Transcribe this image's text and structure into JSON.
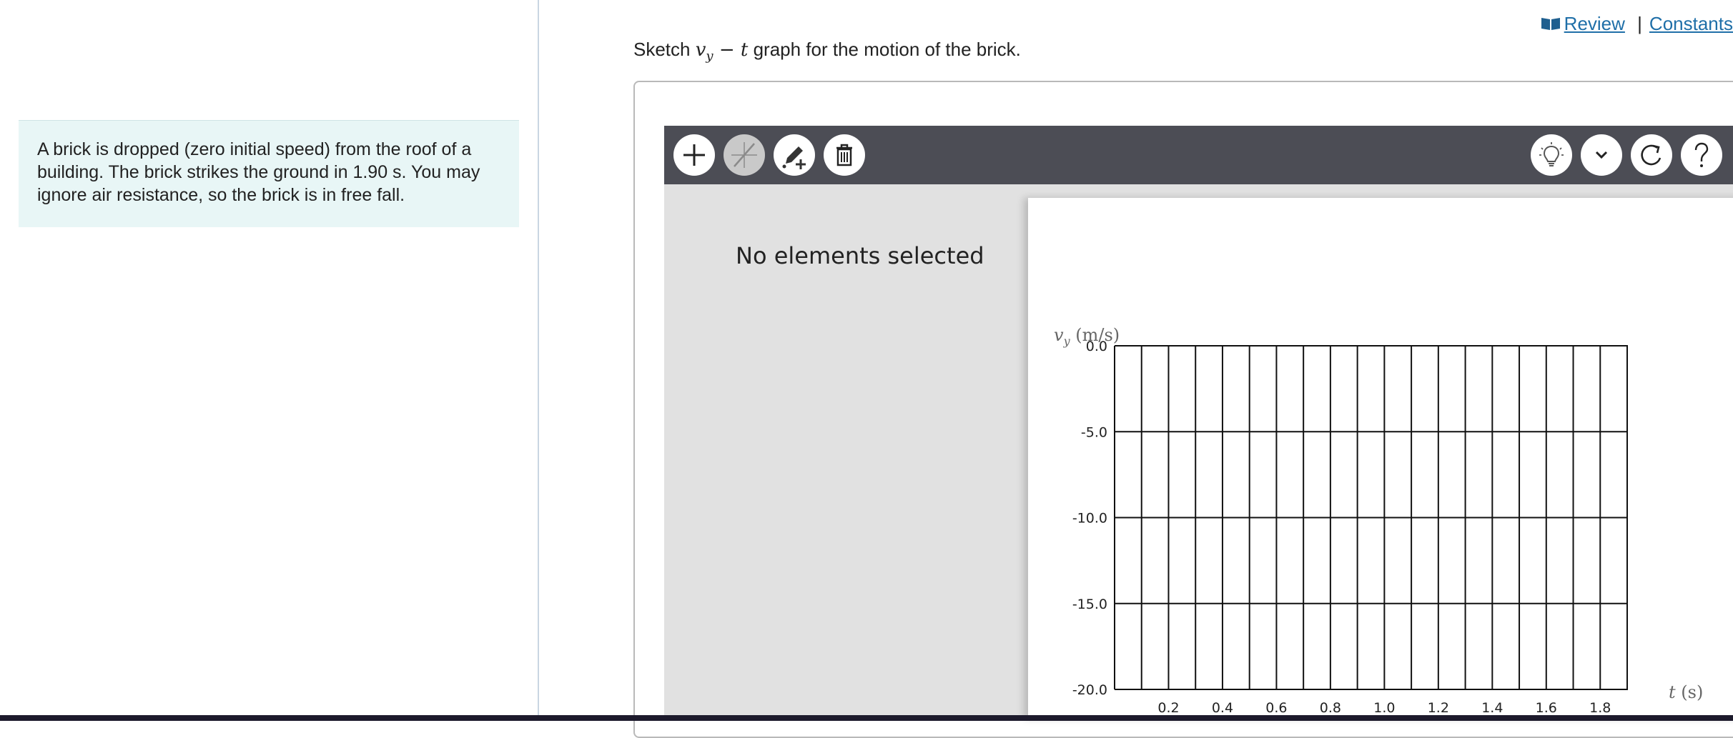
{
  "problem": {
    "text": "A brick is dropped (zero initial speed) from the roof of a building. The brick strikes the ground in 1.90 s. You may ignore air resistance, so the brick is in free fall."
  },
  "top_links": {
    "review": "Review",
    "separator": "|",
    "constants": "Constants"
  },
  "prompt": {
    "before": "Sketch ",
    "math_v": "v",
    "math_sub": "y",
    "math_rest": " − t",
    "after": " graph for the motion of the brick."
  },
  "toolbar": {
    "left_buttons": [
      {
        "name": "add-point-button",
        "icon": "plus-icon",
        "enabled": true
      },
      {
        "name": "line-tool-button",
        "icon": "line-cross-icon",
        "enabled": false
      },
      {
        "name": "draw-tool-button",
        "icon": "pencil-plus-icon",
        "enabled": true
      },
      {
        "name": "delete-button",
        "icon": "trash-icon",
        "enabled": true
      }
    ],
    "right_buttons": [
      {
        "name": "hint-button",
        "icon": "lightbulb-icon"
      },
      {
        "name": "options-button",
        "icon": "chevron-down-icon"
      },
      {
        "name": "reset-button",
        "icon": "redo-icon"
      },
      {
        "name": "help-button",
        "icon": "question-icon"
      }
    ]
  },
  "side_panel": {
    "status": "No elements selected"
  },
  "chart_data": {
    "type": "line",
    "series": [],
    "y_axis_label": "v_y (m/s)",
    "x_axis_label": "t (s)",
    "y_ticks": [
      "0.0",
      "-5.0",
      "-10.0",
      "-15.0",
      "-20.0"
    ],
    "x_ticks": [
      "0.2",
      "0.4",
      "0.6",
      "0.8",
      "1.0",
      "1.2",
      "1.4",
      "1.6",
      "1.8"
    ],
    "xlim": [
      0,
      1.9
    ],
    "ylim": [
      -20,
      0
    ],
    "x_grid_step": 0.1,
    "y_grid_step": 5,
    "grid": true
  }
}
